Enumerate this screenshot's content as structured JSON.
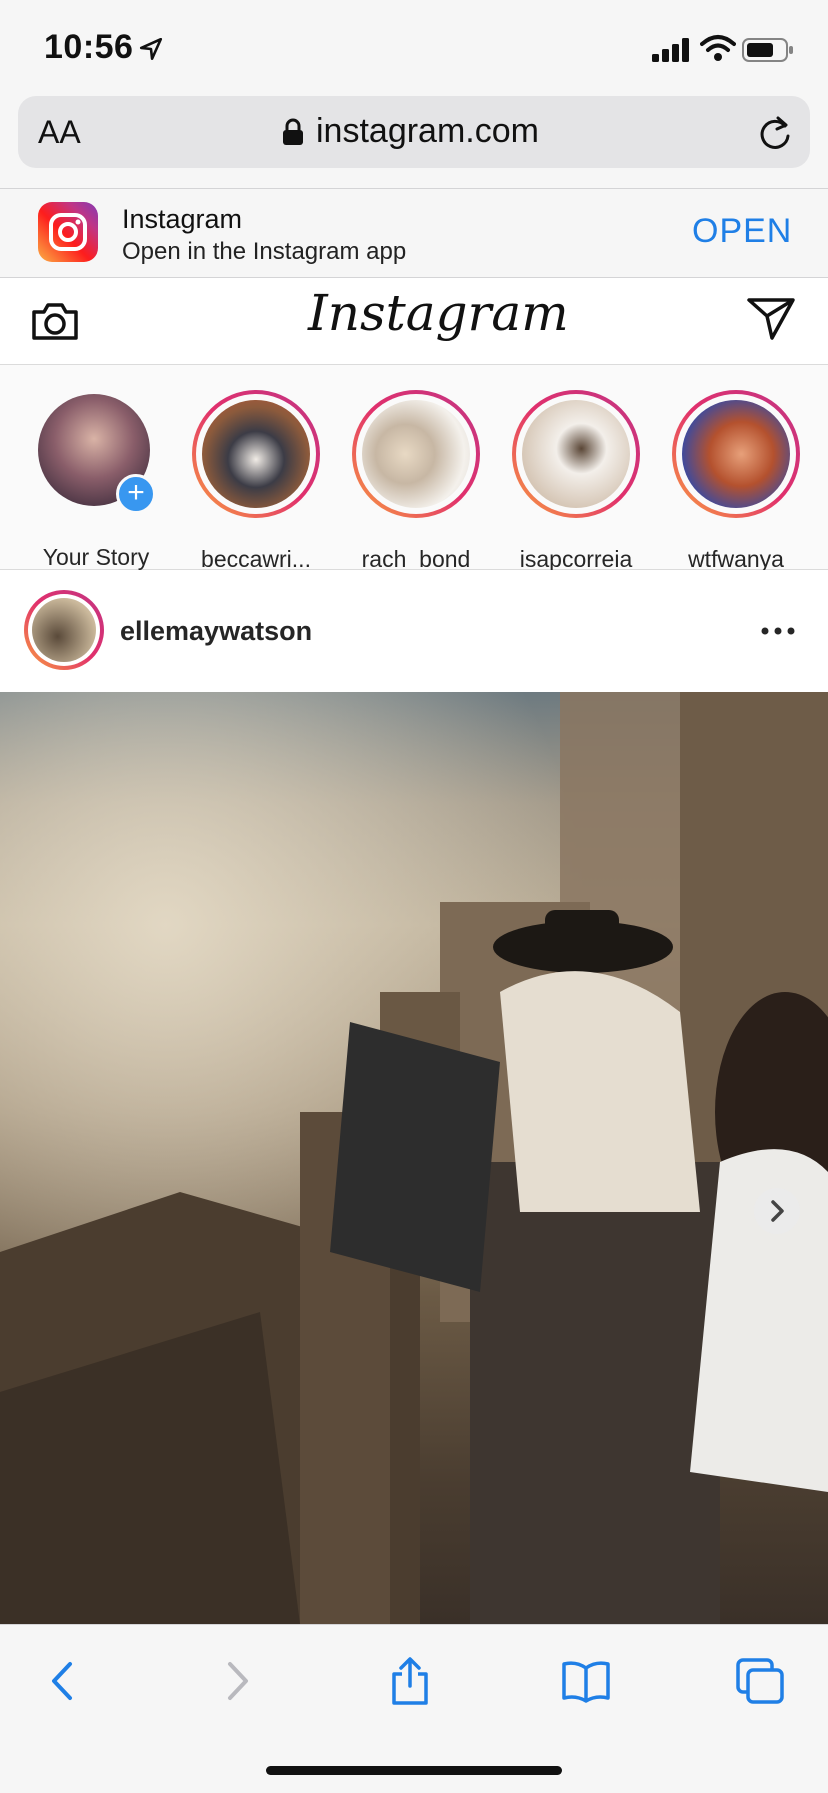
{
  "status_bar": {
    "time": "10:56"
  },
  "browser": {
    "text_size_label": "AA",
    "url": "instagram.com"
  },
  "app_banner": {
    "app_name": "Instagram",
    "subtitle": "Open in the Instagram app",
    "open_label": "OPEN"
  },
  "header": {
    "logo_text": "Instagram"
  },
  "stories": [
    {
      "label": "Your Story",
      "colors": [
        "#7a5a64",
        "#c9a39a"
      ]
    },
    {
      "label": "beccawri...",
      "colors": [
        "#8b5a3c",
        "#e9e2d8"
      ]
    },
    {
      "label": "rach_bond",
      "colors": [
        "#d8cfc4",
        "#f3efe8"
      ]
    },
    {
      "label": "isapcorreia",
      "colors": [
        "#e7ddd0",
        "#cfbfae"
      ]
    },
    {
      "label": "wtfwanya",
      "colors": [
        "#2b3a8c",
        "#c8643c"
      ]
    }
  ],
  "post": {
    "username": "ellemaywatson"
  },
  "colors": {
    "accent": "#1f7fe6",
    "story_ring_start": "#f9a03f",
    "story_ring_end": "#c13584"
  }
}
